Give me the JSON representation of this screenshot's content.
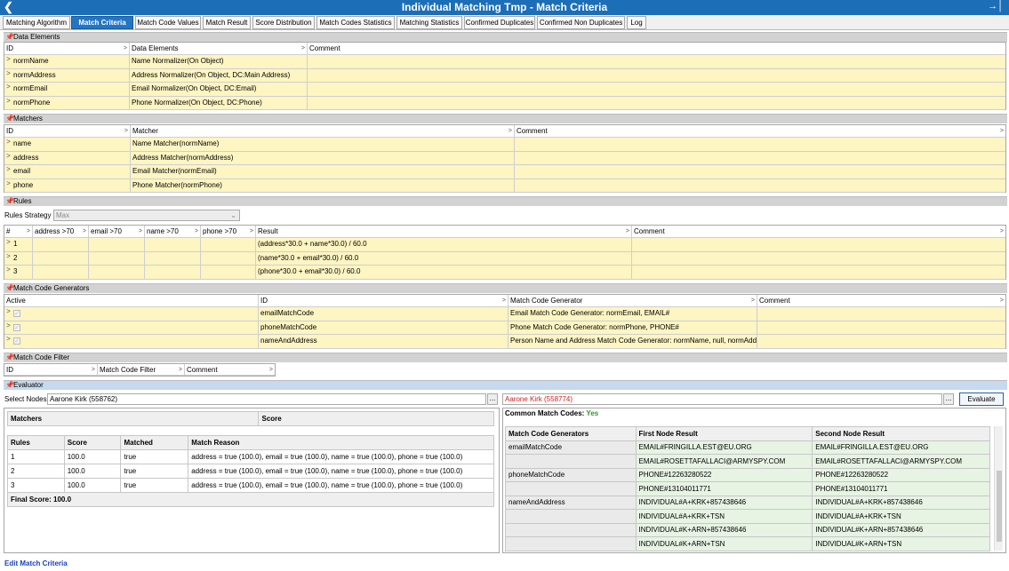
{
  "window": {
    "title": "Individual Matching Tmp - Match Criteria"
  },
  "tabs": [
    "Matching Algorithm",
    "Match Criteria",
    "Match Code Values",
    "Match Result",
    "Score Distribution",
    "Match Codes Statistics",
    "Matching Statistics",
    "Confirmed Duplicates",
    "Confirmed Non Duplicates",
    "Log"
  ],
  "sections": {
    "data_elements": "Data Elements",
    "matchers": "Matchers",
    "rules": "Rules",
    "match_code_generators": "Match Code Generators",
    "match_code_filter": "Match Code Filter",
    "evaluator": "Evaluator"
  },
  "data_elements": {
    "columns": [
      "ID",
      "Data Elements",
      "Comment"
    ],
    "rows": [
      {
        "id": "normName",
        "element": "Name Normalizer(On Object)",
        "comment": ""
      },
      {
        "id": "normAddress",
        "element": "Address Normalizer(On Object, DC:Main Address)",
        "comment": ""
      },
      {
        "id": "normEmail",
        "element": "Email Normalizer(On Object, DC:Email)",
        "comment": ""
      },
      {
        "id": "normPhone",
        "element": "Phone Normalizer(On Object, DC:Phone)",
        "comment": ""
      }
    ]
  },
  "matchers": {
    "columns": [
      "ID",
      "Matcher",
      "Comment"
    ],
    "rows": [
      {
        "id": "name",
        "matcher": "Name Matcher(normName)",
        "comment": ""
      },
      {
        "id": "address",
        "matcher": "Address Matcher(normAddress)",
        "comment": ""
      },
      {
        "id": "email",
        "matcher": "Email Matcher(normEmail)",
        "comment": ""
      },
      {
        "id": "phone",
        "matcher": "Phone Matcher(normPhone)",
        "comment": ""
      }
    ]
  },
  "rules": {
    "strategy_label": "Rules Strategy",
    "strategy_value": "Max",
    "columns": [
      "#",
      "address >70",
      "email >70",
      "name >70",
      "phone >70",
      "Result",
      "Comment"
    ],
    "rows": [
      {
        "n": "1",
        "result": "(address*30.0 + name*30.0) / 60.0"
      },
      {
        "n": "2",
        "result": "(name*30.0 + email*30.0) / 60.0"
      },
      {
        "n": "3",
        "result": "(phone*30.0 + email*30.0) / 60.0"
      }
    ]
  },
  "match_code_generators": {
    "columns": [
      "Active",
      "ID",
      "Match Code Generator",
      "Comment"
    ],
    "rows": [
      {
        "id": "emailMatchCode",
        "generator": "Email Match Code Generator: normEmail, EMAIL#"
      },
      {
        "id": "phoneMatchCode",
        "generator": "Phone Match Code Generator: normPhone, PHONE#"
      },
      {
        "id": "nameAndAddress",
        "generator": "Person Name and Address Match Code Generator: normName, null, normAddres..."
      }
    ]
  },
  "match_code_filter": {
    "columns": [
      "ID",
      "Match Code Filter",
      "Comment"
    ]
  },
  "evaluator": {
    "select_nodes_label": "Select Nodes",
    "node1": "Aarone Kirk (558762)",
    "node2": "Aarone Kirk (558774)",
    "browse": "...",
    "evaluate": "Evaluate",
    "matchers_header": [
      "Matchers",
      "Score"
    ],
    "rules_header": [
      "Rules",
      "Score",
      "Matched",
      "Match Reason"
    ],
    "rules_rows": [
      {
        "rule": "1",
        "score": "100.0",
        "matched": "true",
        "reason": "address = true (100.0), email = true (100.0), name = true (100.0), phone = true (100.0)"
      },
      {
        "rule": "2",
        "score": "100.0",
        "matched": "true",
        "reason": "address = true (100.0), email = true (100.0), name = true (100.0), phone = true (100.0)"
      },
      {
        "rule": "3",
        "score": "100.0",
        "matched": "true",
        "reason": "address = true (100.0), email = true (100.0), name = true (100.0), phone = true (100.0)"
      }
    ],
    "final_score": "Final Score: 100.0",
    "common_codes_label": "Common Match Codes:",
    "common_codes_value": "Yes",
    "codes_header": [
      "Match Code Generators",
      "First Node Result",
      "Second Node Result"
    ],
    "codes_groups": [
      {
        "gen": "emailMatchCode",
        "rows": [
          [
            "EMAIL#FRINGILLA.EST@EU.ORG",
            "EMAIL#FRINGILLA.EST@EU.ORG"
          ],
          [
            "EMAIL#ROSETTAFALLACI@ARMYSPY.COM",
            "EMAIL#ROSETTAFALLACI@ARMYSPY.COM"
          ]
        ]
      },
      {
        "gen": "phoneMatchCode",
        "rows": [
          [
            "PHONE#12263280522",
            "PHONE#12263280522"
          ],
          [
            "PHONE#13104011771",
            "PHONE#13104011771"
          ]
        ]
      },
      {
        "gen": "nameAndAddress",
        "rows": [
          [
            "INDIVIDUAL#A+KRK+857438646",
            "INDIVIDUAL#A+KRK+857438646"
          ],
          [
            "INDIVIDUAL#A+KRK+TSN",
            "INDIVIDUAL#A+KRK+TSN"
          ],
          [
            "INDIVIDUAL#K+ARN+857438646",
            "INDIVIDUAL#K+ARN+857438646"
          ],
          [
            "INDIVIDUAL#K+ARN+TSN",
            "INDIVIDUAL#K+ARN+TSN"
          ]
        ]
      }
    ]
  },
  "footer_link": "Edit Match Criteria"
}
